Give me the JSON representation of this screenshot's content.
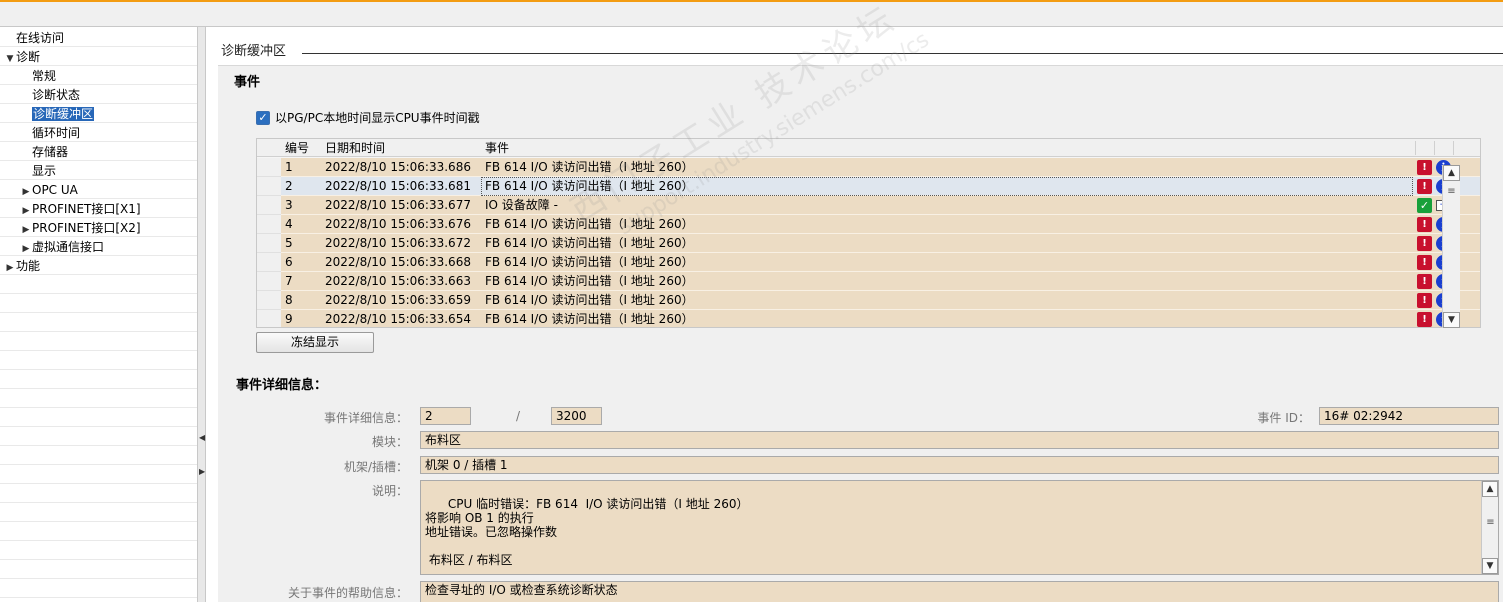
{
  "nav": {
    "items": [
      {
        "label": "在线访问",
        "indent": 0,
        "toggle": ""
      },
      {
        "label": "诊断",
        "indent": 0,
        "toggle": "▼"
      },
      {
        "label": "常规",
        "indent": 1,
        "toggle": ""
      },
      {
        "label": "诊断状态",
        "indent": 1,
        "toggle": ""
      },
      {
        "label": "诊断缓冲区",
        "indent": 1,
        "toggle": "",
        "selected": true
      },
      {
        "label": "循环时间",
        "indent": 1,
        "toggle": ""
      },
      {
        "label": "存储器",
        "indent": 1,
        "toggle": ""
      },
      {
        "label": "显示",
        "indent": 1,
        "toggle": ""
      },
      {
        "label": "OPC UA",
        "indent": 1,
        "toggle": "▶"
      },
      {
        "label": "PROFINET接口[X1]",
        "indent": 1,
        "toggle": "▶"
      },
      {
        "label": "PROFINET接口[X2]",
        "indent": 1,
        "toggle": "▶"
      },
      {
        "label": "虚拟通信接口",
        "indent": 1,
        "toggle": "▶"
      },
      {
        "label": "功能",
        "indent": 0,
        "toggle": "▶"
      }
    ]
  },
  "section_title": "诊断缓冲区",
  "events_heading": "事件",
  "checkbox_label": "以PG/PC本地时间显示CPU事件时间戳",
  "table": {
    "headers": {
      "no": "编号",
      "datetime": "日期和时间",
      "event": "事件"
    },
    "rows": [
      {
        "no": "1",
        "datetime": "2022/8/10 15:06:33.686",
        "event": "FB 614  I/O 读访问出错（I 地址 260）",
        "icons": [
          "err",
          "info"
        ]
      },
      {
        "no": "2",
        "datetime": "2022/8/10 15:06:33.681",
        "event": "FB 614  I/O 读访问出错（I 地址 260）",
        "icons": [
          "err",
          "info"
        ],
        "selected": true
      },
      {
        "no": "3",
        "datetime": "2022/8/10 15:06:33.677",
        "event": "IO 设备故障 -",
        "icons": [
          "ok",
          "out"
        ]
      },
      {
        "no": "4",
        "datetime": "2022/8/10 15:06:33.676",
        "event": "FB 614  I/O 读访问出错（I 地址 260）",
        "icons": [
          "err",
          "info"
        ]
      },
      {
        "no": "5",
        "datetime": "2022/8/10 15:06:33.672",
        "event": "FB 614  I/O 读访问出错（I 地址 260）",
        "icons": [
          "err",
          "info"
        ]
      },
      {
        "no": "6",
        "datetime": "2022/8/10 15:06:33.668",
        "event": "FB 614  I/O 读访问出错（I 地址 260）",
        "icons": [
          "err",
          "info"
        ]
      },
      {
        "no": "7",
        "datetime": "2022/8/10 15:06:33.663",
        "event": "FB 614  I/O 读访问出错（I 地址 260）",
        "icons": [
          "err",
          "info"
        ]
      },
      {
        "no": "8",
        "datetime": "2022/8/10 15:06:33.659",
        "event": "FB 614  I/O 读访问出错（I 地址 260）",
        "icons": [
          "err",
          "info"
        ]
      },
      {
        "no": "9",
        "datetime": "2022/8/10 15:06:33.654",
        "event": "FB 614  I/O 读访问出错（I 地址 260）",
        "icons": [
          "err",
          "info"
        ]
      }
    ]
  },
  "freeze_button": "冻结显示",
  "detail": {
    "heading": "事件详细信息：",
    "detail_label": "事件详细信息：",
    "detail_value_1": "2",
    "separator": "/",
    "detail_value_2": "3200",
    "event_id_label": "事件 ID：",
    "event_id_value": "16# 02:2942",
    "module_label": "模块：",
    "module_value": "布料区",
    "rack_label": "机架/插槽：",
    "rack_value": "机架 0 / 插槽 1",
    "desc_label": "说明：",
    "desc_value": "CPU 临时错误：FB 614  I/O 读访问出错（I 地址 260）\n将影响 OB 1 的执行\n地址错误。已忽略操作数\n\n 布料区 / 布料区",
    "help_label": "关于事件的帮助信息：",
    "help_value": "检查寻址的 I/O 或检查系统诊断状态"
  },
  "watermark": {
    "line1": "西门子工业  技术论坛",
    "line2": "support.industry.siemens.com/cs"
  },
  "colors": {
    "accent": "#f39c12",
    "row_bg": "#ecdcc4",
    "selection": "#2767b8",
    "error": "#c8102e",
    "info": "#1a3fd0",
    "ok": "#18a03a"
  }
}
